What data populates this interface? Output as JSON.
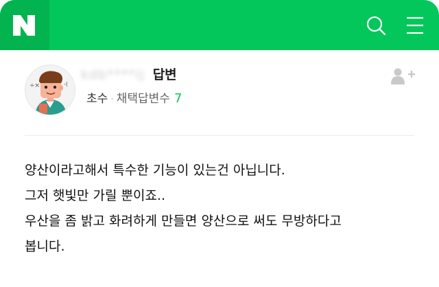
{
  "header": {
    "logo": "N",
    "brand_color": "#03c75a",
    "icons": [
      "search-icon",
      "menu-icon"
    ]
  },
  "profile": {
    "username_masked": "kdb****ij",
    "role": "답변",
    "rank": "초수",
    "separator": "·",
    "adopted_label": "채택답변수",
    "adopted_count": "7"
  },
  "answer": {
    "lines": [
      "양산이라고해서 특수한 기능이 있는건 아닙니다.",
      "그저 햇빛만 가릴 뿐이죠..",
      "우산을 좀 밝고 화려하게 만들면 양산으로 써도 무방하다고",
      "봅니다."
    ]
  }
}
